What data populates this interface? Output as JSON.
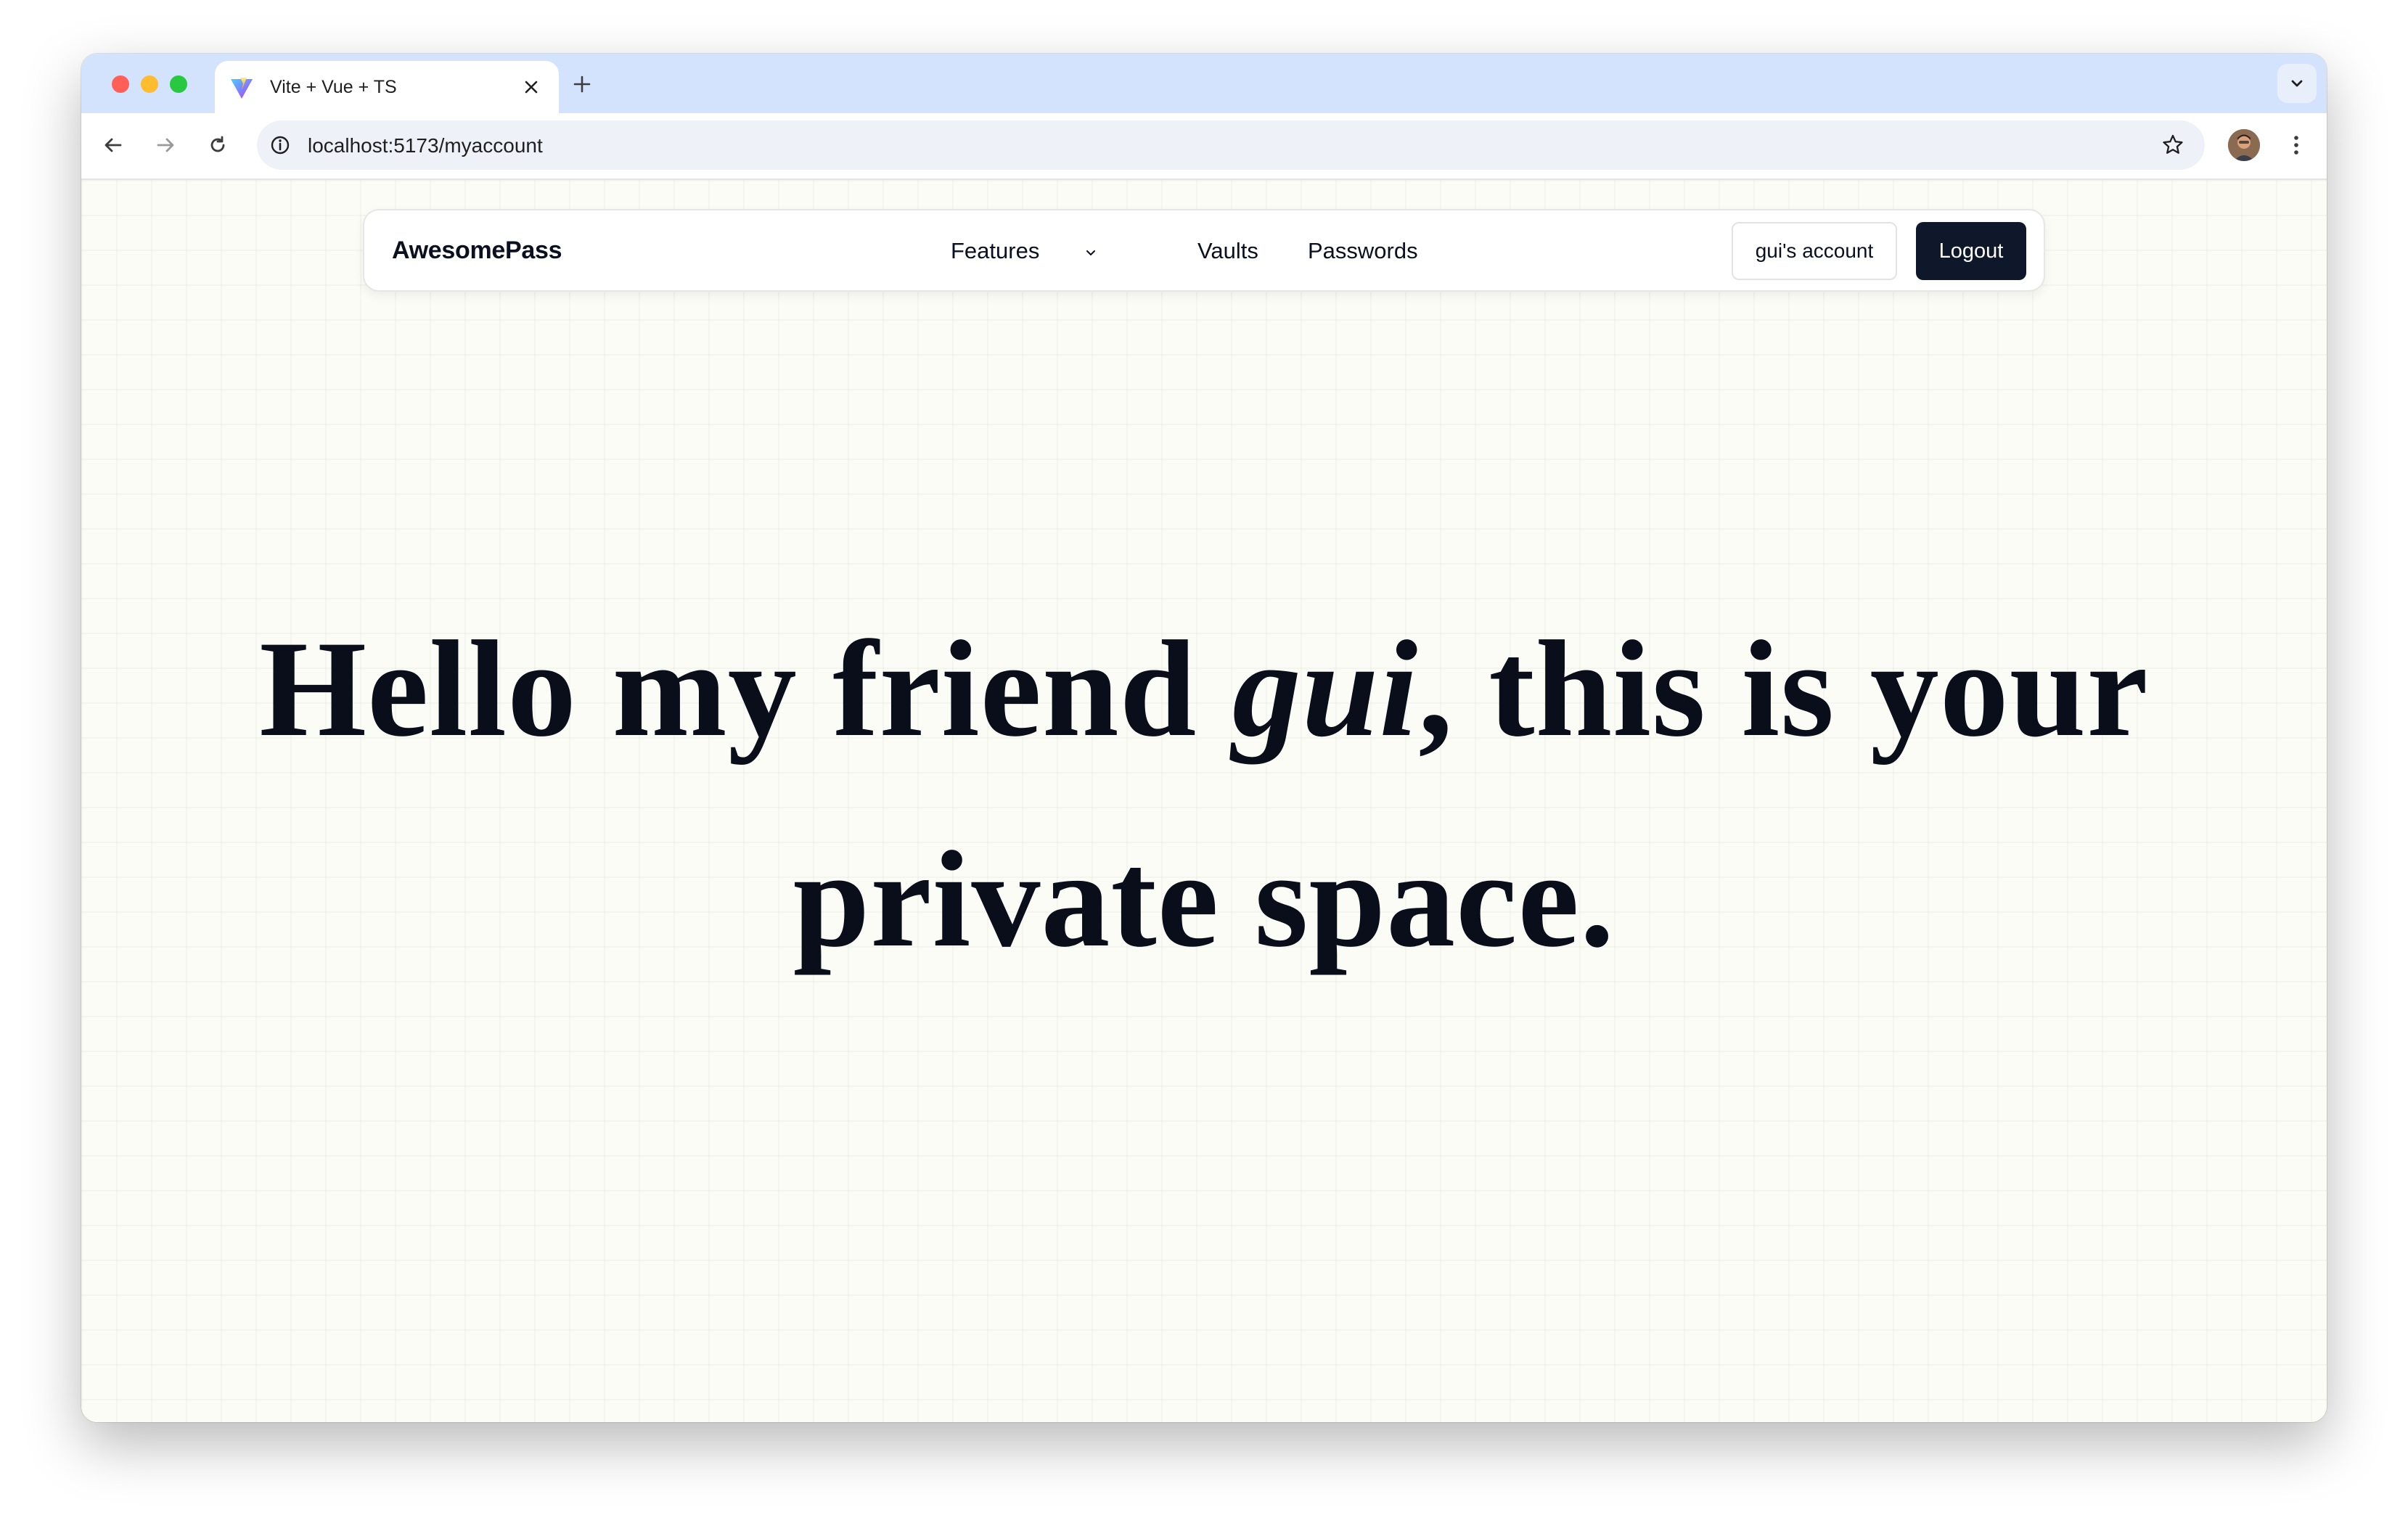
{
  "browser": {
    "tab": {
      "title": "Vite + Vue + TS",
      "favicon": "vite-logo-icon"
    },
    "address": {
      "url": "localhost:5173/myaccount"
    }
  },
  "app": {
    "brand": "AwesomePass",
    "nav": {
      "features": "Features",
      "vaults": "Vaults",
      "passwords": "Passwords"
    },
    "account_button": "gui's account",
    "logout_button": "Logout"
  },
  "hero": {
    "before_name": "Hello my friend ",
    "name": "gui",
    "after_name": ", this is your private space."
  },
  "colors": {
    "tabstrip": "#d3e3fd",
    "page_background": "#fcfcf6",
    "primary_button": "#0f172a",
    "text": "#0a0d1a"
  }
}
